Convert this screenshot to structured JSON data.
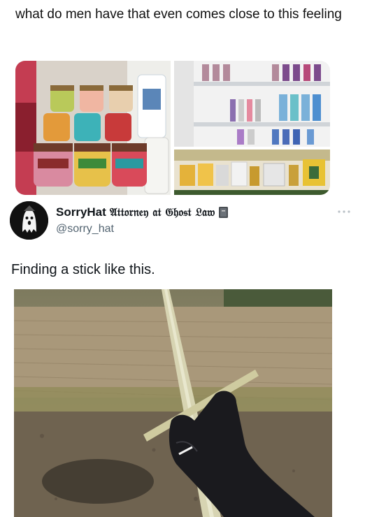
{
  "post": {
    "caption": "what do men have that even comes close to this feeling"
  },
  "images": {
    "left": {
      "alt": "body scrub jars",
      "jar_labels": [
        "PINEAPPLE",
        "WATERMELON",
        "PINEAPPLE",
        "WATERMELON"
      ]
    },
    "right_top": {
      "alt": "store shelves"
    },
    "right_bottom": {
      "alt": "store display"
    }
  },
  "quoted_tweet": {
    "display_name": "SorryHat",
    "display_name_suffix": "𝔄𝔱𝔱𝔬𝔯𝔫𝔢𝔶 𝔞𝔱 𝔊𝔥𝔬𝔰𝔱 𝔏𝔞𝔴",
    "handle": "@sorry_hat",
    "text": "Finding a stick like this."
  },
  "icons": {
    "avatar": "ghost-avatar",
    "badge": "book-icon",
    "more": "more-dots-icon"
  }
}
